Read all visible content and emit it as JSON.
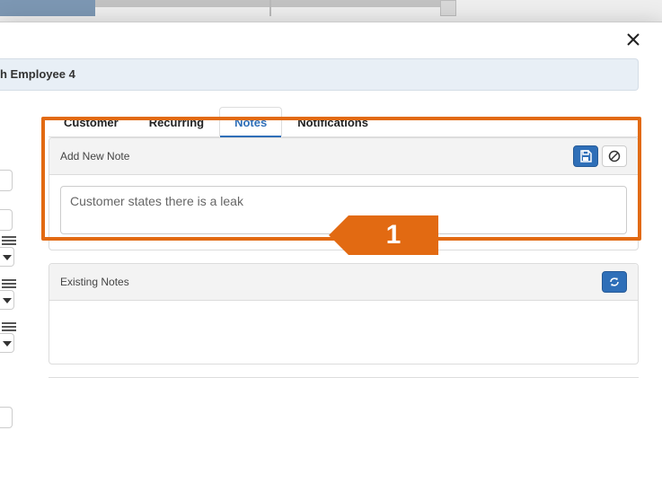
{
  "header": {
    "title": "h Employee 4"
  },
  "tabs": {
    "customer": "Customer",
    "recurring": "Recurring",
    "notes": "Notes",
    "notifications": "Notifications",
    "active": "notes"
  },
  "add_note": {
    "panel_title": "Add New Note",
    "note_text": "Customer states there is a leak"
  },
  "existing_notes": {
    "panel_title": "Existing Notes"
  },
  "callout": {
    "number": "1"
  }
}
